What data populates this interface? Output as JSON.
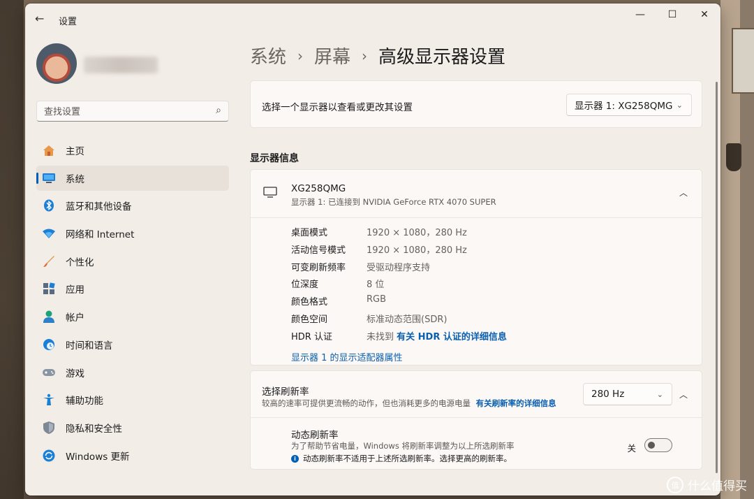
{
  "window": {
    "title": "设置",
    "controls": {
      "minimize": "—",
      "maximize": "☐",
      "close": "✕"
    }
  },
  "search": {
    "placeholder": "查找设置"
  },
  "sidebar": {
    "items": [
      {
        "label": "主页",
        "icon": "home-icon"
      },
      {
        "label": "系统",
        "icon": "system-display-icon",
        "active": true
      },
      {
        "label": "蓝牙和其他设备",
        "icon": "bluetooth-icon"
      },
      {
        "label": "网络和 Internet",
        "icon": "wifi-icon"
      },
      {
        "label": "个性化",
        "icon": "brush-icon"
      },
      {
        "label": "应用",
        "icon": "apps-icon"
      },
      {
        "label": "帐户",
        "icon": "account-icon"
      },
      {
        "label": "时间和语言",
        "icon": "globe-clock-icon"
      },
      {
        "label": "游戏",
        "icon": "gamepad-icon"
      },
      {
        "label": "辅助功能",
        "icon": "accessibility-icon"
      },
      {
        "label": "隐私和安全性",
        "icon": "shield-icon"
      },
      {
        "label": "Windows 更新",
        "icon": "update-icon"
      }
    ]
  },
  "breadcrumb": {
    "level1": "系统",
    "level2": "屏幕",
    "current": "高级显示器设置"
  },
  "monitor_select": {
    "label": "选择一个显示器以查看或更改其设置",
    "value": "显示器 1: XG258QMG"
  },
  "display_info": {
    "section_title": "显示器信息",
    "name": "XG258QMG",
    "subtitle": "显示器 1: 已连接到 NVIDIA GeForce RTX 4070 SUPER",
    "rows": [
      {
        "key": "桌面模式",
        "value": "1920 × 1080，280 Hz"
      },
      {
        "key": "活动信号模式",
        "value": "1920 × 1080，280 Hz"
      },
      {
        "key": "可变刷新频率",
        "value": "受驱动程序支持"
      },
      {
        "key": "位深度",
        "value": "8 位"
      },
      {
        "key": "颜色格式",
        "value": "RGB"
      },
      {
        "key": "颜色空间",
        "value": "标准动态范围(SDR)"
      },
      {
        "key": "HDR 认证",
        "value": "未找到",
        "link": "有关 HDR 认证的详细信息"
      }
    ],
    "adapter_link": "显示器 1 的显示适配器属性"
  },
  "refresh_rate": {
    "title": "选择刷新率",
    "description": "较高的速率可提供更流畅的动作，但也消耗更多的电源电量",
    "link": "有关刷新率的详细信息",
    "value": "280 Hz",
    "dynamic": {
      "title": "动态刷新率",
      "description": "为了帮助节省电量，Windows 将刷新率调整为以上所选刷新率",
      "note": "动态刷新率不适用于上述所选刷新率。选择更高的刷新率。",
      "toggle_label": "关",
      "toggle_on": false
    }
  },
  "watermark": {
    "text": "什么值得买",
    "badge": "值"
  }
}
